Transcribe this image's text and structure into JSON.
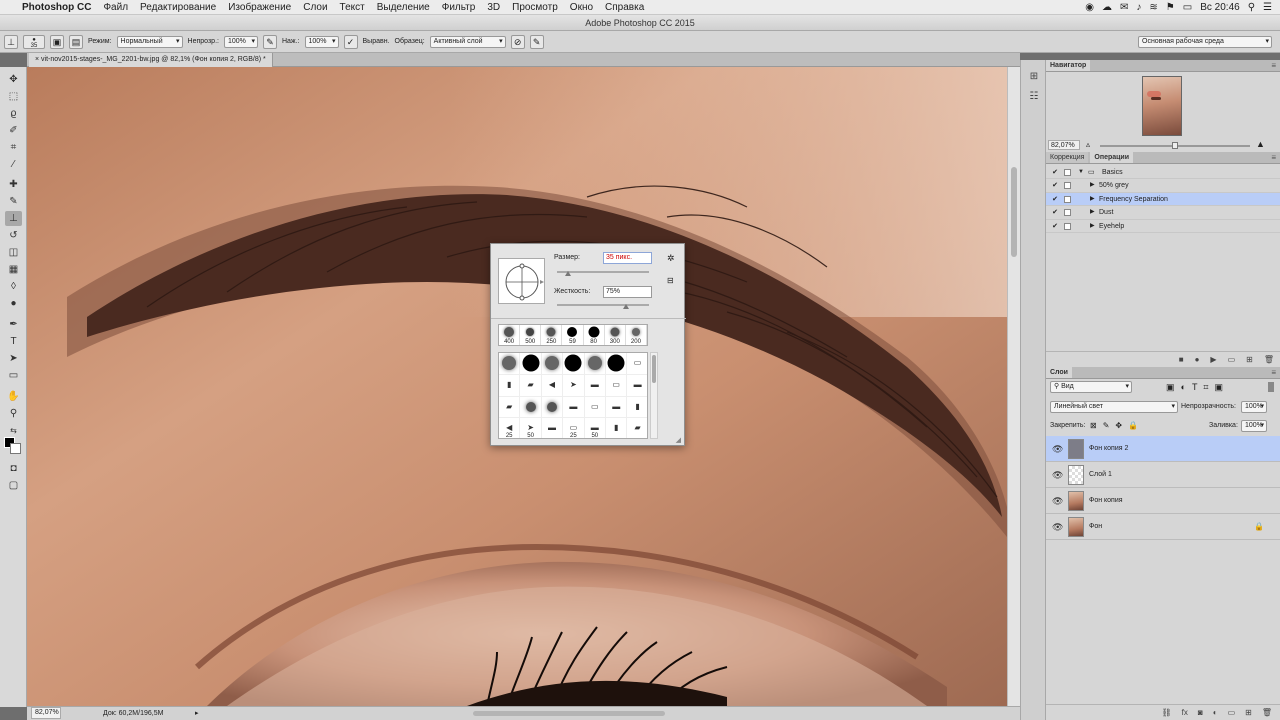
{
  "menubar": {
    "app_name": "Photoshop CC",
    "items": [
      "Файл",
      "Редактирование",
      "Изображение",
      "Слои",
      "Текст",
      "Выделение",
      "Фильтр",
      "3D",
      "Просмотр",
      "Окно",
      "Справка"
    ],
    "clock": "Вс 20:46"
  },
  "window_title": "Adobe Photoshop CC 2015",
  "options_bar": {
    "brush_size": "35",
    "mode_label": "Режим:",
    "mode_value": "Нормальный",
    "opacity_label": "Непрозр.:",
    "opacity_value": "100%",
    "pressure_label": "Наж.:",
    "pressure_value": "100%",
    "aligned_label": "Выравн.",
    "sample_label": "Образец:",
    "sample_value": "Активный слой",
    "workspace": "Основная рабочая среда"
  },
  "document_tab": "vit-nov2015-stages-_MG_2201-bw.jpg @ 82,1% (Фон копия 2, RGB/8) *",
  "status_bar": {
    "zoom": "82,07%",
    "doc_info": "Док: 60,2M/196,5M"
  },
  "navigator": {
    "tab": "Навигатор",
    "zoom": "82,07%"
  },
  "actions_panel": {
    "tabs": [
      "Коррекция",
      "Операции"
    ],
    "active_tab": "Операции",
    "items": [
      {
        "label": "Basics",
        "type": "set",
        "checked": true,
        "expanded": true
      },
      {
        "label": "50% grey",
        "type": "action",
        "checked": true
      },
      {
        "label": "Frequency Separation",
        "type": "action",
        "checked": true,
        "selected": true
      },
      {
        "label": "Dust",
        "type": "action",
        "checked": true
      },
      {
        "label": "Eyehelp",
        "type": "action",
        "checked": true
      }
    ]
  },
  "layers_panel": {
    "tab": "Слои",
    "filter": "Вид",
    "blend_mode": "Линейный свет",
    "opacity_label": "Непрозрачность:",
    "opacity_value": "100%",
    "lock_label": "Закрепить:",
    "fill_label": "Заливка:",
    "fill_value": "100%",
    "layers": [
      {
        "name": "Фон копия 2",
        "selected": true,
        "thumb": "gray"
      },
      {
        "name": "Слой 1",
        "selected": false,
        "thumb": "transparent"
      },
      {
        "name": "Фон копия",
        "selected": false,
        "thumb": "photo"
      },
      {
        "name": "Фон",
        "selected": false,
        "thumb": "photo",
        "locked": true
      }
    ]
  },
  "brush_popup": {
    "size_label": "Размер:",
    "size_value": "35 пикс.",
    "hardness_label": "Жесткость:",
    "hardness_value": "75%",
    "size_fraction": 0.12,
    "hardness_fraction": 0.75,
    "recent_presets": [
      "400",
      "500",
      "250",
      "59",
      "80",
      "300",
      "200"
    ],
    "grid_numbers": [
      "25",
      "50",
      "25",
      "50"
    ]
  },
  "colors": {
    "accent_selection": "#b9cdf7",
    "skin": "#c99070"
  }
}
